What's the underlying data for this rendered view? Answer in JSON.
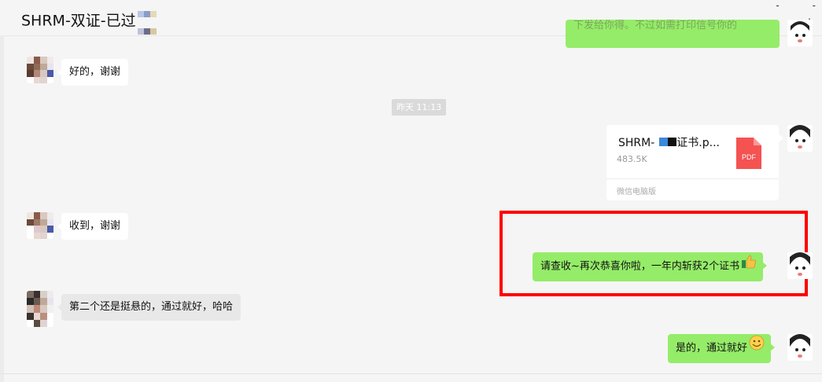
{
  "header": {
    "title": "SHRM-双证-已过"
  },
  "messages": {
    "top_partial_text": "下发给你得。不过如需打印信号你的",
    "left_1": "好的，谢谢",
    "timestamp": "昨天 11:13",
    "file": {
      "name_prefix": "SHRM-",
      "name_suffix": "证书.p...",
      "size": "483.5K",
      "source": "微信电脑版",
      "type_label": "PDF"
    },
    "left_2": "收到，谢谢",
    "right_1": "请查收~再次恭喜你啦，一年内斩获2个证书",
    "left_3": "第二个还是挺悬的，通过就好，哈哈",
    "right_2": "是的，通过就好"
  },
  "icons": {
    "thumbs_up": "thumbs-up-emoji",
    "smile": "grin-emoji",
    "pdf": "pdf-file-icon"
  },
  "colors": {
    "bubble_self": "#95ec69",
    "bubble_other": "#ffffff",
    "highlight_box": "#ff0000",
    "pdf_red": "#f55252"
  }
}
